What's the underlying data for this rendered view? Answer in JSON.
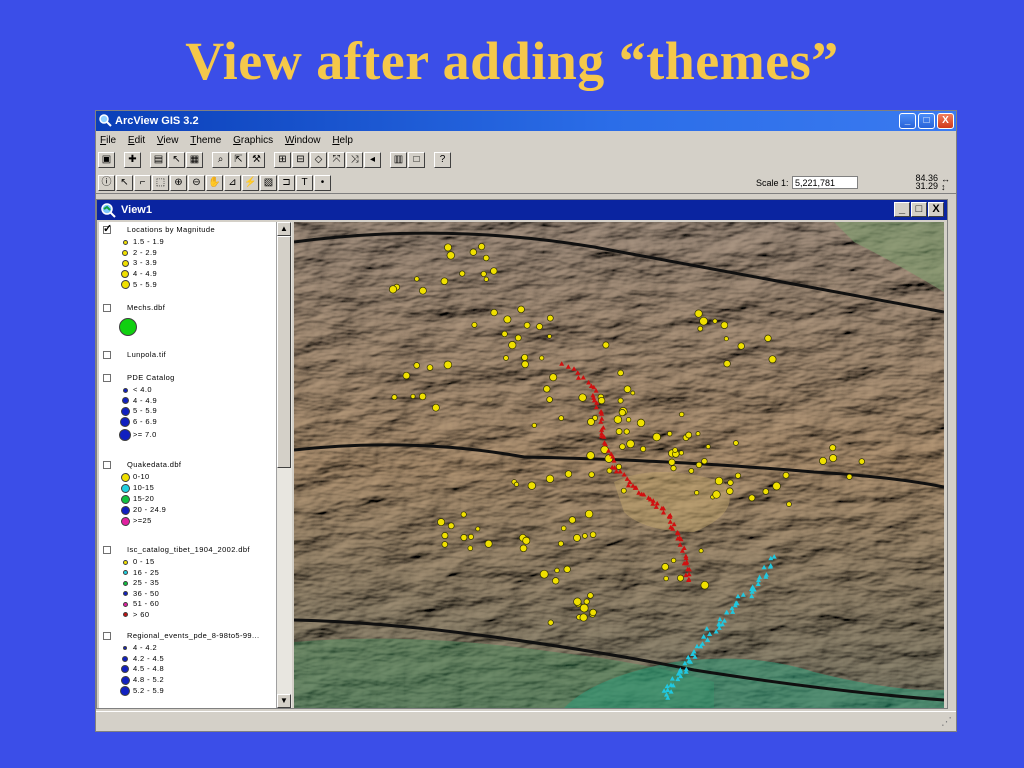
{
  "slide": {
    "title": "View after adding “themes”"
  },
  "window": {
    "title": "ArcView GIS 3.2",
    "minimize": "_",
    "maximize": "□",
    "close": "X"
  },
  "menu": [
    {
      "label": "File",
      "key": "F",
      "rest": "ile"
    },
    {
      "label": "Edit",
      "key": "E",
      "rest": "dit"
    },
    {
      "label": "View",
      "key": "V",
      "rest": "iew"
    },
    {
      "label": "Theme",
      "key": "T",
      "rest": "heme"
    },
    {
      "label": "Graphics",
      "key": "G",
      "rest": "raphics"
    },
    {
      "label": "Window",
      "key": "W",
      "rest": "indow"
    },
    {
      "label": "Help",
      "key": "H",
      "rest": "elp"
    }
  ],
  "toolbar": {
    "scale_label": "Scale 1:",
    "scale_value": "5,221,781",
    "coord_x": "84.36",
    "coord_y": "31.29"
  },
  "view": {
    "title": "View1",
    "minimize": "_",
    "maximize": "□",
    "close": "X"
  },
  "themes": [
    {
      "name": "Locations by Magnitude",
      "checked": true,
      "classes": [
        {
          "label": "1.5 - 1.9",
          "color": "#f0e000",
          "size": 5
        },
        {
          "label": "2 - 2.9",
          "color": "#f0e000",
          "size": 6
        },
        {
          "label": "3 - 3.9",
          "color": "#f0e000",
          "size": 7
        },
        {
          "label": "4 - 4.9",
          "color": "#f0e000",
          "size": 8
        },
        {
          "label": "5 - 5.9",
          "color": "#f0e000",
          "size": 9
        }
      ]
    },
    {
      "name": "Mechs.dbf",
      "checked": false,
      "classes": [
        {
          "label": "",
          "color": "#10d010",
          "size": 18
        }
      ]
    },
    {
      "name": "Lunpola.tif",
      "checked": false,
      "classes": []
    },
    {
      "name": "PDE Catalog",
      "checked": false,
      "classes": [
        {
          "label": "< 4.0",
          "color": "#1020c0",
          "size": 5
        },
        {
          "label": "4 - 4.9",
          "color": "#1020c0",
          "size": 7
        },
        {
          "label": "5 - 5.9",
          "color": "#1020c0",
          "size": 9
        },
        {
          "label": "6 - 6.9",
          "color": "#1020c0",
          "size": 10
        },
        {
          "label": ">= 7.0",
          "color": "#1020c0",
          "size": 12
        }
      ]
    },
    {
      "name": "Quakedata.dbf",
      "checked": false,
      "classes": [
        {
          "label": "0-10",
          "color": "#f0e000",
          "size": 9
        },
        {
          "label": "10-15",
          "color": "#20d0e0",
          "size": 9
        },
        {
          "label": "15-20",
          "color": "#10c040",
          "size": 9
        },
        {
          "label": "20 - 24.9",
          "color": "#1020c0",
          "size": 9
        },
        {
          "label": ">=25",
          "color": "#e020a0",
          "size": 9
        }
      ]
    },
    {
      "name": "Isc_catalog_tibet_1904_2002.dbf",
      "checked": false,
      "classes": [
        {
          "label": "0 - 15",
          "color": "#f0e000",
          "size": 5
        },
        {
          "label": "16 - 25",
          "color": "#20d0e0",
          "size": 5
        },
        {
          "label": "25 - 35",
          "color": "#10c040",
          "size": 5
        },
        {
          "label": "36 - 50",
          "color": "#1020c0",
          "size": 5
        },
        {
          "label": "51 - 60",
          "color": "#e020a0",
          "size": 5
        },
        {
          "label": "> 60",
          "color": "#c01010",
          "size": 5
        }
      ]
    },
    {
      "name": "Regional_events_pde_8-98to5-99...",
      "checked": false,
      "classes": [
        {
          "label": "4 - 4.2",
          "color": "#1020c0",
          "size": 4
        },
        {
          "label": "4.2 - 4.5",
          "color": "#1020c0",
          "size": 6
        },
        {
          "label": "4.5 - 4.8",
          "color": "#1020c0",
          "size": 8
        },
        {
          "label": "4.8 - 5.2",
          "color": "#1020c0",
          "size": 9
        },
        {
          "label": "5.2 - 5.9",
          "color": "#1020c0",
          "size": 10
        }
      ]
    }
  ],
  "icons": [
    "arcview-app-icon",
    "view-icon",
    "check-icon",
    "scroll-up-icon",
    "scroll-down-icon"
  ]
}
